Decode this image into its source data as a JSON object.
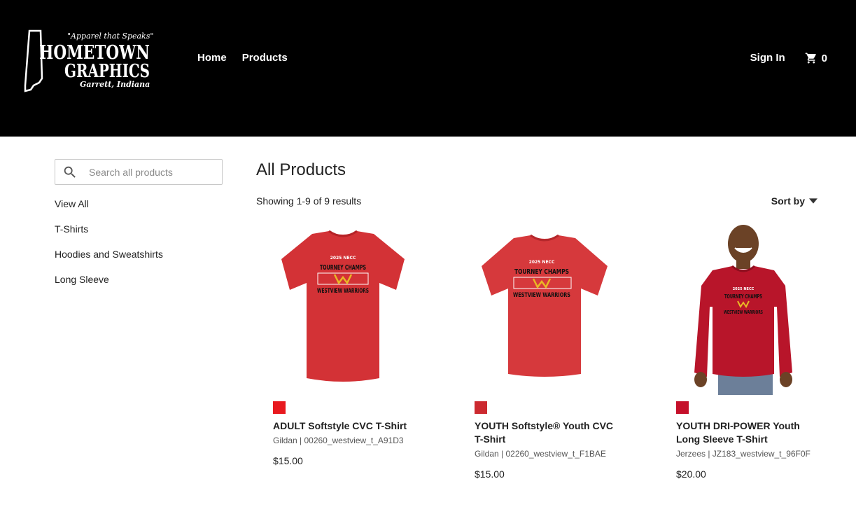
{
  "header": {
    "logo": {
      "tagline": "\"Apparel that Speaks\"",
      "line1": "HOMETOWN",
      "line2": "GRAPHICS",
      "location": "Garrett, Indiana"
    },
    "nav": {
      "home": "Home",
      "products": "Products"
    },
    "sign_in": "Sign In",
    "cart_count": "0"
  },
  "sidebar": {
    "search_placeholder": "Search all products",
    "categories": [
      "View All",
      "T-Shirts",
      "Hoodies and Sweatshirts",
      "Long Sleeve"
    ]
  },
  "main": {
    "title": "All Products",
    "results_text": "Showing 1-9 of 9 results",
    "sort_label": "Sort by"
  },
  "products": [
    {
      "name": "ADULT Softstyle CVC T-Shirt",
      "meta": "Gildan | 00260_westview_t_A91D3",
      "price": "$15.00",
      "swatch": "#e8191f",
      "garment_color": "#d33236",
      "print": {
        "line1": "2025 NECC",
        "line2": "TOURNEY CHAMPS",
        "line3": "WESTVIEW WARRIORS"
      }
    },
    {
      "name": "YOUTH Softstyle® Youth CVC T-Shirt",
      "meta": "Gildan | 02260_westview_t_F1BAE",
      "price": "$15.00",
      "swatch": "#cc2a30",
      "garment_color": "#d6393c",
      "print": {
        "line1": "2025 NECC",
        "line2": "TOURNEY CHAMPS",
        "line3": "WESTVIEW WARRIORS"
      }
    },
    {
      "name": "YOUTH DRI-POWER Youth Long Sleeve T-Shirt",
      "meta": "Jerzees | JZ183_westview_t_96F0F",
      "price": "$20.00",
      "swatch": "#c5102a",
      "garment_color": "#b8152a",
      "print": {
        "line1": "2025 NECC",
        "line2": "TOURNEY CHAMPS",
        "line3": "WESTVIEW WARRIORS"
      }
    }
  ]
}
